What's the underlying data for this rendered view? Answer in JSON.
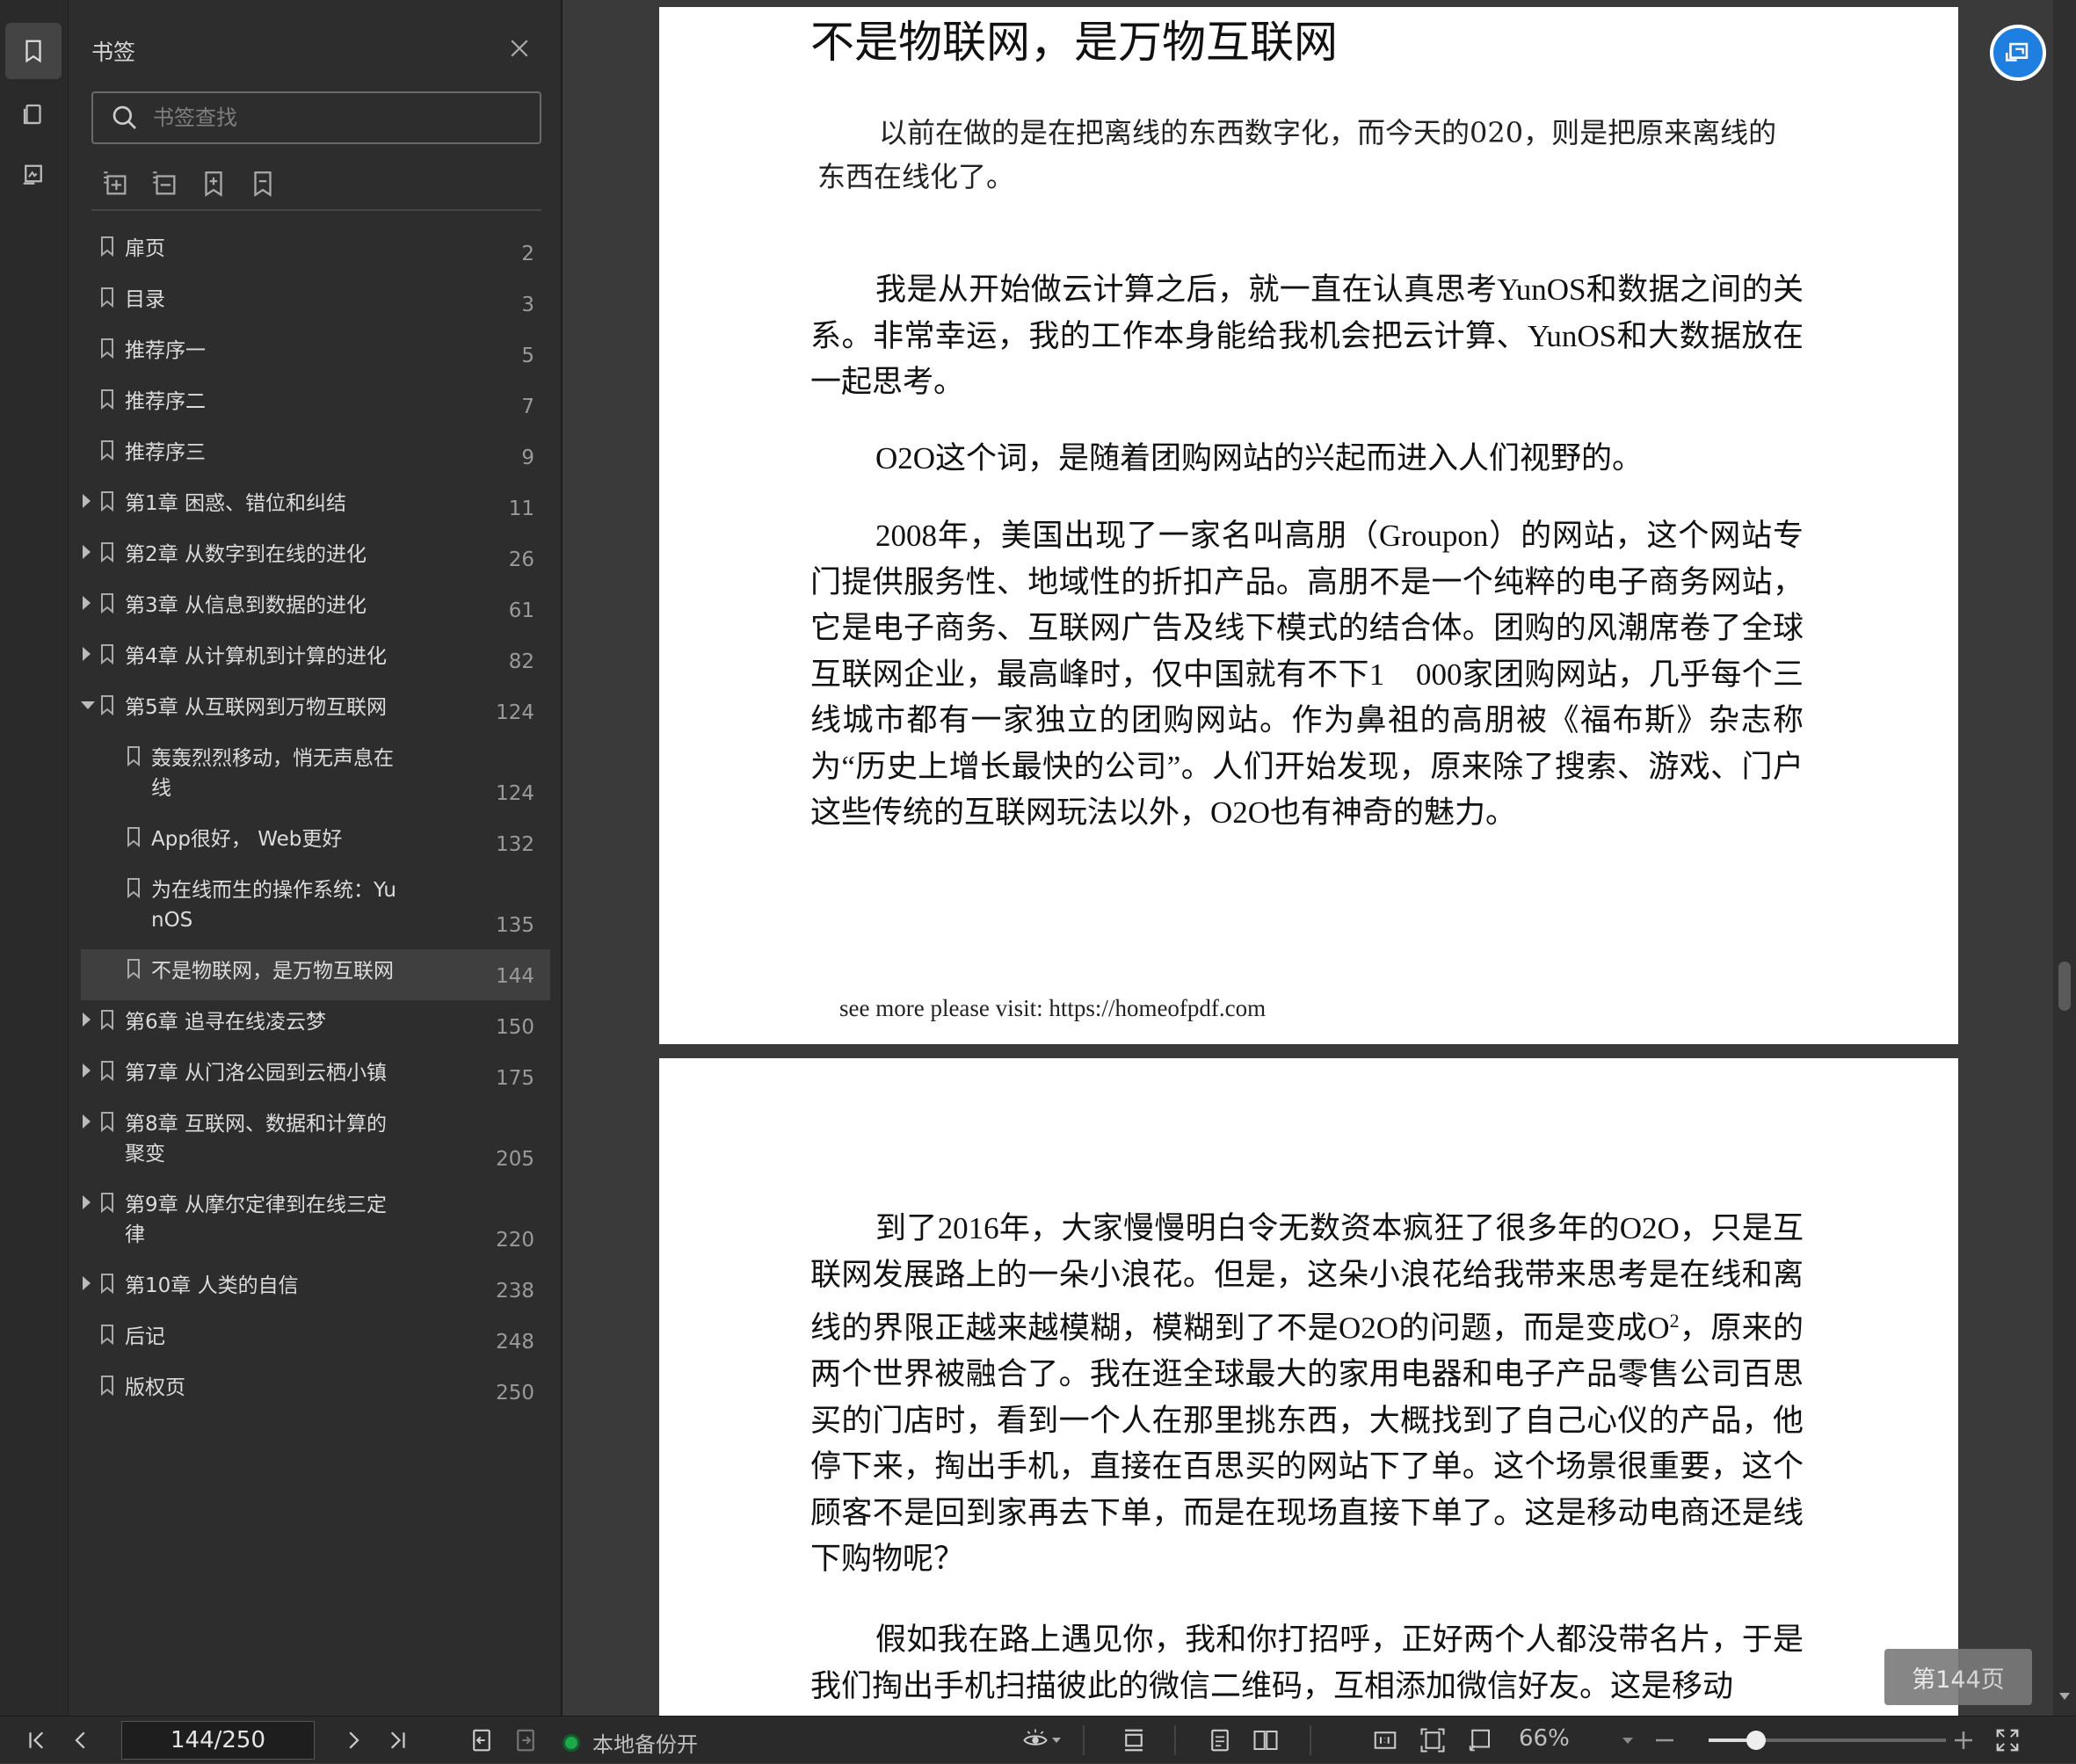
{
  "panel": {
    "title": "书签",
    "search_placeholder": "书签查找"
  },
  "bookmarks": [
    {
      "label": "扉页",
      "page": "2",
      "level": 0,
      "expand": "none"
    },
    {
      "label": "目录",
      "page": "3",
      "level": 0,
      "expand": "none"
    },
    {
      "label": "推荐序一",
      "page": "5",
      "level": 0,
      "expand": "none"
    },
    {
      "label": "推荐序二",
      "page": "7",
      "level": 0,
      "expand": "none"
    },
    {
      "label": "推荐序三",
      "page": "9",
      "level": 0,
      "expand": "none"
    },
    {
      "label": "第1章 困惑、错位和纠结",
      "page": "11",
      "level": 0,
      "expand": "closed"
    },
    {
      "label": "第2章 从数字到在线的进化",
      "page": "26",
      "level": 0,
      "expand": "closed"
    },
    {
      "label": "第3章 从信息到数据的进化",
      "page": "61",
      "level": 0,
      "expand": "closed"
    },
    {
      "label": "第4章 从计算机到计算的进化",
      "page": "82",
      "level": 0,
      "expand": "closed"
    },
    {
      "label": "第5章 从互联网到万物互联网",
      "page": "124",
      "level": 0,
      "expand": "open"
    },
    {
      "label": "轰轰烈烈移动，悄无声息在\n线",
      "page": "124",
      "level": 1,
      "expand": "none"
    },
    {
      "label": "App很好， Web更好",
      "page": "132",
      "level": 1,
      "expand": "none"
    },
    {
      "label": "为在线而生的操作系统：Yu\nnOS",
      "page": "135",
      "level": 1,
      "expand": "none"
    },
    {
      "label": "不是物联网，是万物互联网",
      "page": "144",
      "level": 1,
      "expand": "none",
      "selected": true
    },
    {
      "label": "第6章 追寻在线凌云梦",
      "page": "150",
      "level": 0,
      "expand": "closed"
    },
    {
      "label": "第7章 从门洛公园到云栖小镇",
      "page": "175",
      "level": 0,
      "expand": "closed"
    },
    {
      "label": "第8章 互联网、数据和计算的\n聚变",
      "page": "205",
      "level": 0,
      "expand": "closed"
    },
    {
      "label": "第9章 从摩尔定律到在线三定\n律",
      "page": "220",
      "level": 0,
      "expand": "closed"
    },
    {
      "label": "第10章 人类的自信",
      "page": "238",
      "level": 0,
      "expand": "closed"
    },
    {
      "label": "后记",
      "page": "248",
      "level": 0,
      "expand": "none"
    },
    {
      "label": "版权页",
      "page": "250",
      "level": 0,
      "expand": "none"
    }
  ],
  "document": {
    "title": "不是物联网，是万物互联网",
    "quote": "以前在做的是在把离线的东西数字化，而今天的020，则是把原来离线的东西在线化了。",
    "p1": "我是从开始做云计算之后，就一直在认真思考YunOS和数据之间的关系。非常幸运，我的工作本身能给我机会把云计算、YunOS和大数据放在一起思考。",
    "p2": "O2O这个词，是随着团购网站的兴起而进入人们视野的。",
    "p3": "2008年，美国出现了一家名叫高朋（Groupon）的网站，这个网站专门提供服务性、地域性的折扣产品。高朋不是一个纯粹的电子商务网站，它是电子商务、互联网广告及线下模式的结合体。团购的风潮席卷了全球互联网企业，最高峰时，仅中国就有不下1　000家团购网站，几乎每个三线城市都有一家独立的团购网站。作为鼻祖的高朋被《福布斯》杂志称为“历史上增长最快的公司”。人们开始发现，原来除了搜索、游戏、门户这些传统的互联网玩法以外，O2O也有神奇的魅力。",
    "footer": "see more please visit: https://homeofpdf.com",
    "p4a": "到了2016年，大家慢慢明白令无数资本疯狂了很多年的O2O，只是互联网发展路上的一朵小浪花。但是，这朵小浪花给我带来思考是在线和离线的界限正越来越模糊，模糊到了不是O2O的问题，而是变成O",
    "p4sup": "2",
    "p4b": "，原来的两个世界被融合了。我在逛全球最大的家用电器和电子产品零售公司百思买的门店时，看到一个人在那里挑东西，大概找到了自己心仪的产品，他停下来，掏出手机，直接在百思买的网站下了单。这个场景很重要，这个顾客不是回到家再去下单，而是在现场直接下单了。这是移动电商还是线下购物呢？",
    "p5": "假如我在路上遇见你，我和你打招呼，正好两个人都没带名片，于是我们掏出手机扫描彼此的微信二维码，互相添加微信好友。这是移动"
  },
  "page_tip": "第144页",
  "bottom": {
    "page_value": "144/250",
    "backup_label": "本地备份开",
    "zoom_label": "66%",
    "zoom_fraction": 0.2
  },
  "colors": {
    "accent": "#1f7fe0",
    "backup_dot": "#1fa84a"
  }
}
